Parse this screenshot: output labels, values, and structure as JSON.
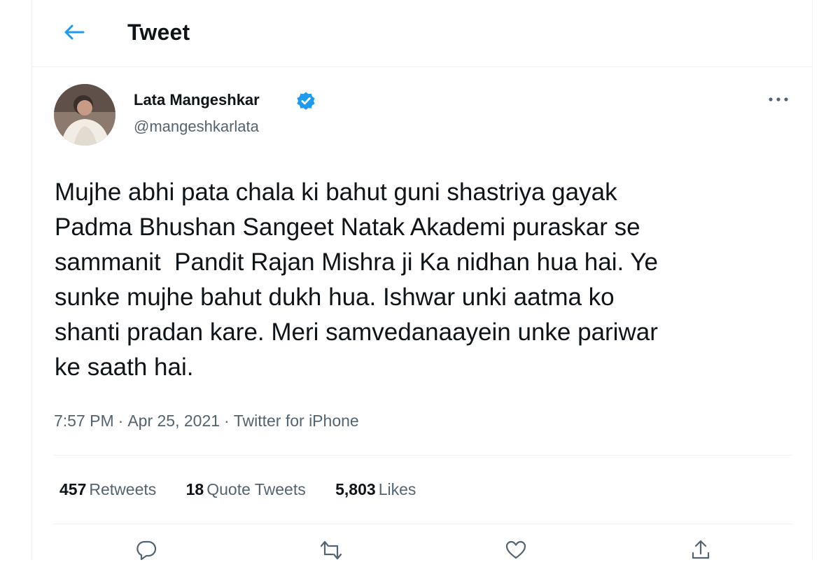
{
  "header": {
    "title": "Tweet",
    "back_icon": "arrow-left-icon"
  },
  "tweet": {
    "author": {
      "name": "Lata Mangeshkar",
      "handle": "@mangeshkarlata",
      "verified_icon": "verified-badge-icon"
    },
    "more_icon": "more-horizontal-icon",
    "text": "Mujhe abhi pata chala ki bahut guni shastriya gayak\nPadma Bhushan Sangeet Natak Akademi puraskar se\nsammanit  Pandit Rajan Mishra ji Ka nidhan hua hai. Ye\nsunke mujhe bahut dukh hua. Ishwar unki aatma ko\nshanti pradan kare. Meri samvedanaayein unke pariwar\nke saath hai.",
    "time": "7:57 PM",
    "separator": "·",
    "date": "Apr 25, 2021",
    "source": "Twitter for iPhone"
  },
  "stats": {
    "retweets": {
      "count": "457",
      "label": "Retweets"
    },
    "quotes": {
      "count": "18",
      "label": "Quote Tweets"
    },
    "likes": {
      "count": "5,803",
      "label": "Likes"
    }
  },
  "actions": [
    "reply-icon",
    "retweet-icon",
    "like-icon",
    "share-icon"
  ],
  "colors": {
    "accent": "#1d9bf0",
    "text": "#0f1419",
    "secondary": "#536471",
    "divider": "#eff3f4"
  }
}
